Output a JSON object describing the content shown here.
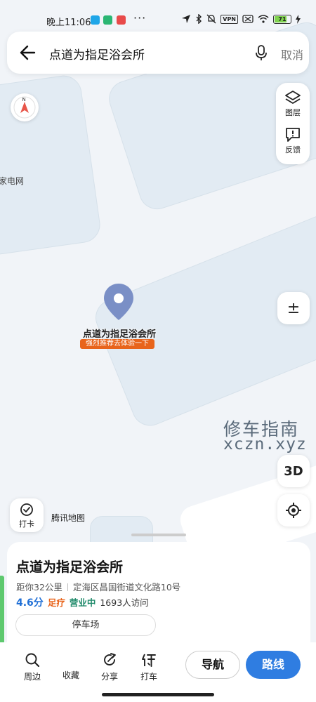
{
  "status_bar": {
    "time": "晚上11:06",
    "more": "···",
    "vpn_label": "VPN",
    "battery_level": "71"
  },
  "search": {
    "query": "点道为指足浴会所",
    "cancel_label": "取消"
  },
  "map": {
    "side_label": "家电网",
    "poi_name": "点道为指足浴会所",
    "poi_tag": "强烈推荐去体验一下",
    "watermark_cn": "修车指南",
    "watermark_url": "xczn.xyz",
    "brand": "腾讯地图"
  },
  "tools": {
    "layers_label": "图层",
    "feedback_label": "反馈",
    "zoom_symbol": "±",
    "view_3d_label": "3D",
    "checkin_label": "打卡"
  },
  "card": {
    "title": "点道为指足浴会所",
    "distance": "距你32公里",
    "address": "定海区昌国街道文化路10号",
    "rating": "4.6分",
    "category": "足疗",
    "open_status": "营业中",
    "visits": "1693人访问",
    "chip_label": "停车场"
  },
  "bottom_bar": {
    "nearby_label": "周边",
    "favorite_label": "收藏",
    "share_label": "分享",
    "taxi_label": "打车",
    "navigate_label": "导航",
    "route_label": "路线"
  },
  "colors": {
    "accent_blue": "#2f7de1",
    "tag_orange": "#e8641b",
    "marker_blue": "#7a8fc6"
  }
}
